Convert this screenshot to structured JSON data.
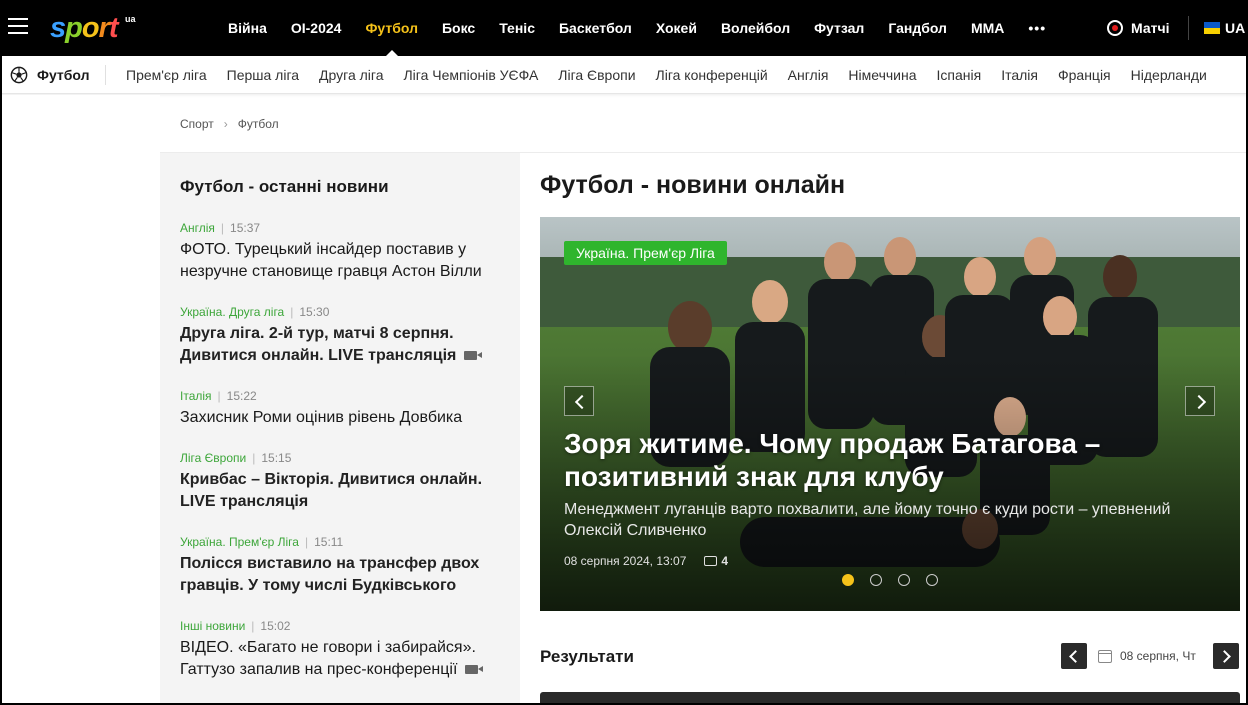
{
  "header": {
    "logo_text": "sport",
    "logo_suffix": "ua",
    "nav": [
      {
        "label": "Війна",
        "active": false
      },
      {
        "label": "ОІ-2024",
        "active": false
      },
      {
        "label": "Футбол",
        "active": true
      },
      {
        "label": "Бокс",
        "active": false
      },
      {
        "label": "Теніс",
        "active": false
      },
      {
        "label": "Баскетбол",
        "active": false
      },
      {
        "label": "Хокей",
        "active": false
      },
      {
        "label": "Волейбол",
        "active": false
      },
      {
        "label": "Футзал",
        "active": false
      },
      {
        "label": "Гандбол",
        "active": false
      },
      {
        "label": "MMA",
        "active": false
      }
    ],
    "more_label": "•••",
    "matches_label": "Матчі",
    "lang_label": "UA",
    "accent_color": "#f5c21a"
  },
  "subnav": {
    "title": "Футбол",
    "items": [
      "Прем'єр ліга",
      "Перша ліга",
      "Друга ліга",
      "Ліга Чемпіонів УЄФА",
      "Ліга Європи",
      "Ліга конференцій",
      "Англія",
      "Німеччина",
      "Іспанія",
      "Італія",
      "Франція",
      "Нідерланди"
    ]
  },
  "breadcrumb": [
    "Спорт",
    "Футбол"
  ],
  "sidebar": {
    "title": "Футбол - останні новини",
    "news": [
      {
        "category": "Англія",
        "time": "15:37",
        "headline": "ФОТО. Турецький інсайдер поставив у незручне становище гравця Астон Вілли",
        "bold": false,
        "video": false
      },
      {
        "category": "Україна. Друга ліга",
        "time": "15:30",
        "headline": "Друга ліга. 2-й тур, матчі 8 серпня. Дивитися онлайн. LIVE трансляція",
        "bold": true,
        "video": true
      },
      {
        "category": "Італія",
        "time": "15:22",
        "headline": "Захисник Роми оцінив рівень Довбика",
        "bold": false,
        "video": false
      },
      {
        "category": "Ліга Європи",
        "time": "15:15",
        "headline": "Кривбас – Вікторія. Дивитися онлайн. LIVE трансляція",
        "bold": true,
        "video": false
      },
      {
        "category": "Україна. Прем'єр Ліга",
        "time": "15:11",
        "headline": "Полісся виставило на трансфер двох гравців. У тому числі Будківського",
        "bold": true,
        "video": false
      },
      {
        "category": "Інші новини",
        "time": "15:02",
        "headline": "ВІДЕО. «Багато не говори і забирайся». Гаттузо запалив на прес-конференції",
        "bold": false,
        "video": true
      }
    ]
  },
  "main": {
    "title": "Футбол - новини онлайн",
    "hero": {
      "tag": "Україна. Прем'єр Ліга",
      "title": "Зоря житиме. Чому продаж Батагова – позитивний знак для клубу",
      "subtitle": "Менеджмент луганців варто похвалити, але йому точно є куди рости – упевнений Олексій Сливченко",
      "date": "08 серпня 2024, 13:07",
      "comments": "4",
      "slides": 4,
      "active_slide": 1
    },
    "results": {
      "title": "Результати",
      "date": "08 серпня, Чт"
    }
  }
}
